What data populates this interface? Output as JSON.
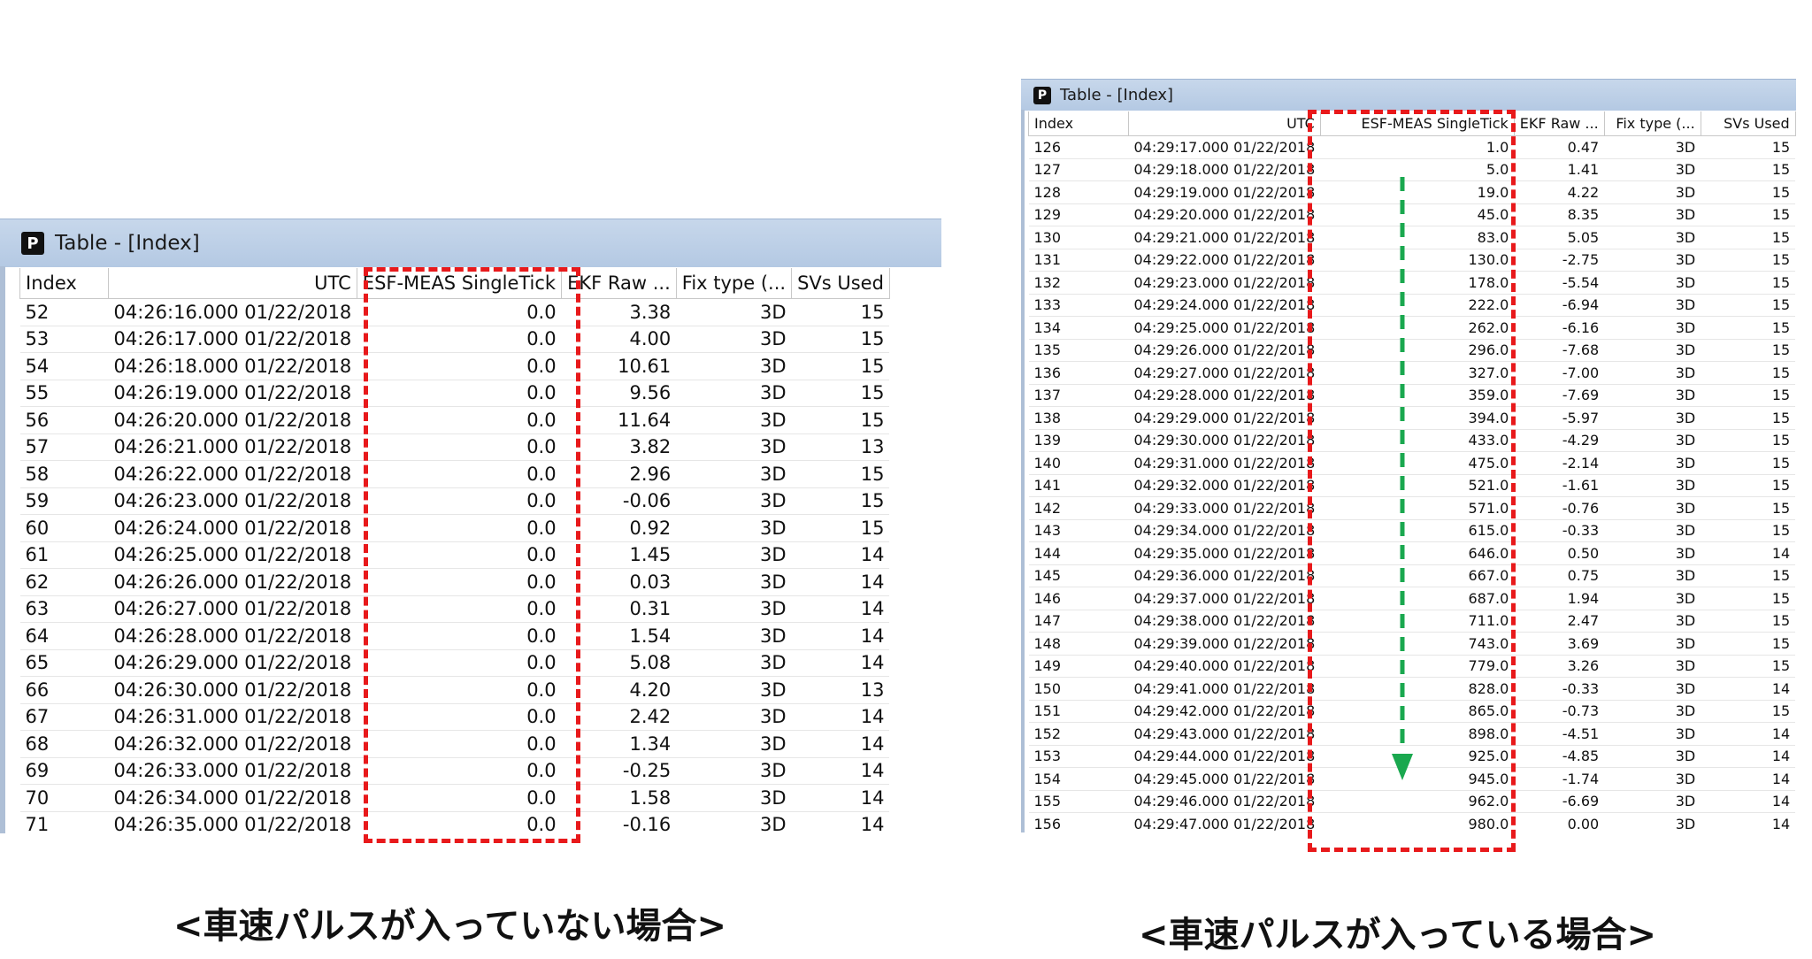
{
  "left_panel": {
    "title": "Table - [Index]",
    "icon": "app-logo-icon",
    "columns": [
      "Index",
      "UTC",
      "ESF-MEAS SingleTick",
      "EKF Raw ...",
      "Fix type (...",
      "SVs Used"
    ],
    "rows": [
      [
        "52",
        "04:26:16.000 01/22/2018",
        "0.0",
        "3.38",
        "3D",
        "15"
      ],
      [
        "53",
        "04:26:17.000 01/22/2018",
        "0.0",
        "4.00",
        "3D",
        "15"
      ],
      [
        "54",
        "04:26:18.000 01/22/2018",
        "0.0",
        "10.61",
        "3D",
        "15"
      ],
      [
        "55",
        "04:26:19.000 01/22/2018",
        "0.0",
        "9.56",
        "3D",
        "15"
      ],
      [
        "56",
        "04:26:20.000 01/22/2018",
        "0.0",
        "11.64",
        "3D",
        "15"
      ],
      [
        "57",
        "04:26:21.000 01/22/2018",
        "0.0",
        "3.82",
        "3D",
        "13"
      ],
      [
        "58",
        "04:26:22.000 01/22/2018",
        "0.0",
        "2.96",
        "3D",
        "15"
      ],
      [
        "59",
        "04:26:23.000 01/22/2018",
        "0.0",
        "-0.06",
        "3D",
        "15"
      ],
      [
        "60",
        "04:26:24.000 01/22/2018",
        "0.0",
        "0.92",
        "3D",
        "15"
      ],
      [
        "61",
        "04:26:25.000 01/22/2018",
        "0.0",
        "1.45",
        "3D",
        "14"
      ],
      [
        "62",
        "04:26:26.000 01/22/2018",
        "0.0",
        "0.03",
        "3D",
        "14"
      ],
      [
        "63",
        "04:26:27.000 01/22/2018",
        "0.0",
        "0.31",
        "3D",
        "14"
      ],
      [
        "64",
        "04:26:28.000 01/22/2018",
        "0.0",
        "1.54",
        "3D",
        "14"
      ],
      [
        "65",
        "04:26:29.000 01/22/2018",
        "0.0",
        "5.08",
        "3D",
        "14"
      ],
      [
        "66",
        "04:26:30.000 01/22/2018",
        "0.0",
        "4.20",
        "3D",
        "13"
      ],
      [
        "67",
        "04:26:31.000 01/22/2018",
        "0.0",
        "2.42",
        "3D",
        "14"
      ],
      [
        "68",
        "04:26:32.000 01/22/2018",
        "0.0",
        "1.34",
        "3D",
        "14"
      ],
      [
        "69",
        "04:26:33.000 01/22/2018",
        "0.0",
        "-0.25",
        "3D",
        "14"
      ],
      [
        "70",
        "04:26:34.000 01/22/2018",
        "0.0",
        "1.58",
        "3D",
        "14"
      ],
      [
        "71",
        "04:26:35.000 01/22/2018",
        "0.0",
        "-0.16",
        "3D",
        "14"
      ]
    ]
  },
  "right_panel": {
    "title": "Table - [Index]",
    "icon": "app-logo-icon",
    "columns": [
      "Index",
      "UTC",
      "ESF-MEAS SingleTick",
      "EKF Raw ...",
      "Fix type (...",
      "SVs Used"
    ],
    "rows": [
      [
        "126",
        "04:29:17.000 01/22/2018",
        "1.0",
        "0.47",
        "3D",
        "15"
      ],
      [
        "127",
        "04:29:18.000 01/22/2018",
        "5.0",
        "1.41",
        "3D",
        "15"
      ],
      [
        "128",
        "04:29:19.000 01/22/2018",
        "19.0",
        "4.22",
        "3D",
        "15"
      ],
      [
        "129",
        "04:29:20.000 01/22/2018",
        "45.0",
        "8.35",
        "3D",
        "15"
      ],
      [
        "130",
        "04:29:21.000 01/22/2018",
        "83.0",
        "5.05",
        "3D",
        "15"
      ],
      [
        "131",
        "04:29:22.000 01/22/2018",
        "130.0",
        "-2.75",
        "3D",
        "15"
      ],
      [
        "132",
        "04:29:23.000 01/22/2018",
        "178.0",
        "-5.54",
        "3D",
        "15"
      ],
      [
        "133",
        "04:29:24.000 01/22/2018",
        "222.0",
        "-6.94",
        "3D",
        "15"
      ],
      [
        "134",
        "04:29:25.000 01/22/2018",
        "262.0",
        "-6.16",
        "3D",
        "15"
      ],
      [
        "135",
        "04:29:26.000 01/22/2018",
        "296.0",
        "-7.68",
        "3D",
        "15"
      ],
      [
        "136",
        "04:29:27.000 01/22/2018",
        "327.0",
        "-7.00",
        "3D",
        "15"
      ],
      [
        "137",
        "04:29:28.000 01/22/2018",
        "359.0",
        "-7.69",
        "3D",
        "15"
      ],
      [
        "138",
        "04:29:29.000 01/22/2018",
        "394.0",
        "-5.97",
        "3D",
        "15"
      ],
      [
        "139",
        "04:29:30.000 01/22/2018",
        "433.0",
        "-4.29",
        "3D",
        "15"
      ],
      [
        "140",
        "04:29:31.000 01/22/2018",
        "475.0",
        "-2.14",
        "3D",
        "15"
      ],
      [
        "141",
        "04:29:32.000 01/22/2018",
        "521.0",
        "-1.61",
        "3D",
        "15"
      ],
      [
        "142",
        "04:29:33.000 01/22/2018",
        "571.0",
        "-0.76",
        "3D",
        "15"
      ],
      [
        "143",
        "04:29:34.000 01/22/2018",
        "615.0",
        "-0.33",
        "3D",
        "15"
      ],
      [
        "144",
        "04:29:35.000 01/22/2018",
        "646.0",
        "0.50",
        "3D",
        "14"
      ],
      [
        "145",
        "04:29:36.000 01/22/2018",
        "667.0",
        "0.75",
        "3D",
        "15"
      ],
      [
        "146",
        "04:29:37.000 01/22/2018",
        "687.0",
        "1.94",
        "3D",
        "15"
      ],
      [
        "147",
        "04:29:38.000 01/22/2018",
        "711.0",
        "2.47",
        "3D",
        "15"
      ],
      [
        "148",
        "04:29:39.000 01/22/2018",
        "743.0",
        "3.69",
        "3D",
        "15"
      ],
      [
        "149",
        "04:29:40.000 01/22/2018",
        "779.0",
        "3.26",
        "3D",
        "15"
      ],
      [
        "150",
        "04:29:41.000 01/22/2018",
        "828.0",
        "-0.33",
        "3D",
        "14"
      ],
      [
        "151",
        "04:29:42.000 01/22/2018",
        "865.0",
        "-0.73",
        "3D",
        "15"
      ],
      [
        "152",
        "04:29:43.000 01/22/2018",
        "898.0",
        "-4.51",
        "3D",
        "14"
      ],
      [
        "153",
        "04:29:44.000 01/22/2018",
        "925.0",
        "-4.85",
        "3D",
        "14"
      ],
      [
        "154",
        "04:29:45.000 01/22/2018",
        "945.0",
        "-1.74",
        "3D",
        "14"
      ],
      [
        "155",
        "04:29:46.000 01/22/2018",
        "962.0",
        "-6.69",
        "3D",
        "14"
      ],
      [
        "156",
        "04:29:47.000 01/22/2018",
        "980.0",
        "0.00",
        "3D",
        "14"
      ]
    ]
  },
  "captions": {
    "left": "<車速パルスが入っていない場合>",
    "right": "<車速パルスが入っている場合>"
  },
  "colors": {
    "highlight_dash": "#e8191b",
    "trend_arrow": "#1aa84f",
    "titlebar": "#b4c9e3"
  }
}
